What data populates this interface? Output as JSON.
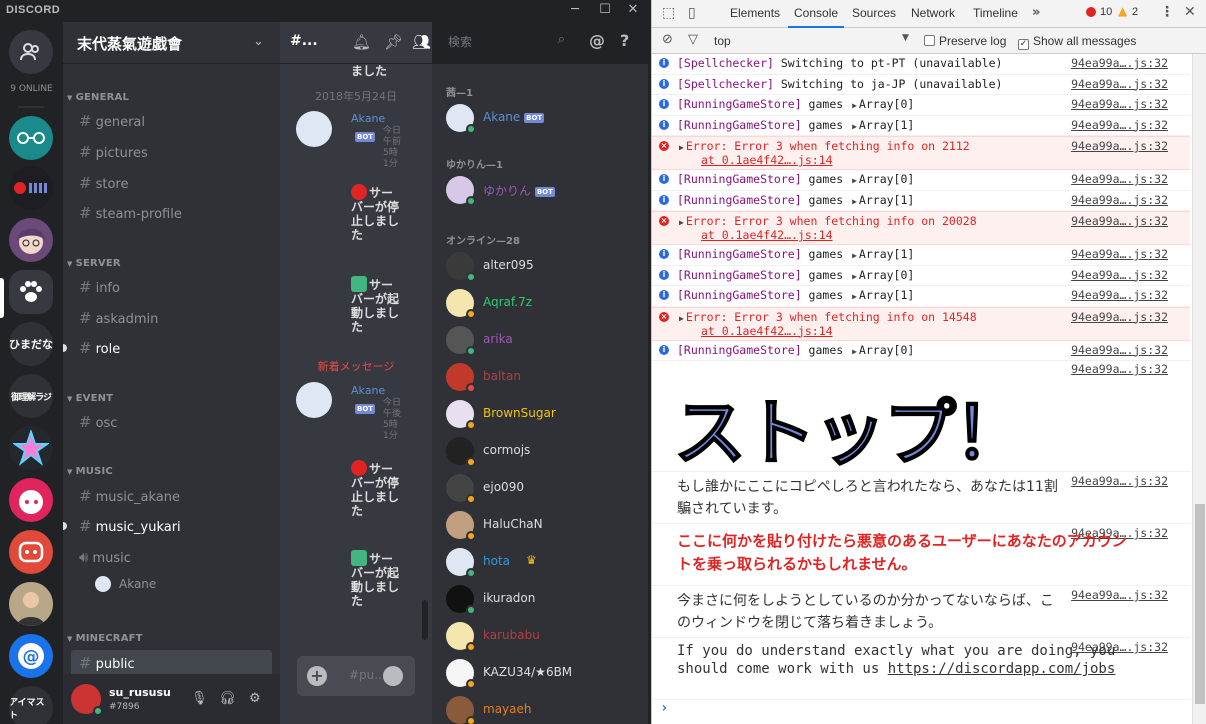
{
  "titlebar": {
    "brand": "DISCORD",
    "min": "─",
    "max": "☐",
    "close": "✕"
  },
  "guilds": {
    "online": "9 ONLINE",
    "items": [
      {
        "label": "ひまだな"
      },
      {
        "label": "御理解ラジ"
      },
      {
        "label": "アイマスト"
      }
    ]
  },
  "server": {
    "name": "末代蒸氣遊戯會"
  },
  "categories": [
    {
      "name": "GENERAL",
      "channels": [
        "general",
        "pictures",
        "store",
        "steam-profile"
      ]
    },
    {
      "name": "SERVER",
      "channels": [
        "info",
        "askadmin",
        "role"
      ]
    },
    {
      "name": "EVENT",
      "channels": [
        "osc"
      ]
    },
    {
      "name": "MUSIC",
      "channels": [
        "music_akane",
        "music_yukari",
        "music"
      ]
    },
    {
      "name": "MINECRAFT",
      "channels": [
        "public"
      ]
    }
  ],
  "voice_user": "Akane",
  "user": {
    "name": "su_rususu",
    "tag": "#7896"
  },
  "chat": {
    "channel": "#...",
    "search_placeholder": "検索",
    "top_text": "ました",
    "date_divider": "2018年5月24日",
    "new_divider": "新着メッセージ",
    "msg1": {
      "author": "Akane",
      "bot": "BOT",
      "time": "今日 午前5時1分"
    },
    "msg2": {
      "author": "Akane",
      "bot": "BOT",
      "time": "今日 午後5時1分"
    },
    "stop_text": "サーバーが停止しました",
    "start_text": "サーバーが起動しました",
    "input_placeholder": "#pu..."
  },
  "members": {
    "groups": [
      {
        "name": "茜—1",
        "items": [
          {
            "name": "Akane",
            "bot": "BOT",
            "color": "#5d8fd0"
          }
        ]
      },
      {
        "name": "ゆかりん—1",
        "items": [
          {
            "name": "ゆかりん",
            "bot": "BOT",
            "color": "#9b59b6"
          }
        ]
      },
      {
        "name": "オンライン—28",
        "items": [
          {
            "name": "alter095",
            "color": "#dcddde",
            "status": "#43b581"
          },
          {
            "name": "Aqraf.7z",
            "color": "#2ecc71",
            "status": "#faa61a"
          },
          {
            "name": "arika",
            "color": "#9b59b6",
            "status": "#43b581"
          },
          {
            "name": "baltan",
            "color": "#b04040",
            "status": "#f04747"
          },
          {
            "name": "BrownSugar",
            "color": "#f1c40f",
            "status": "#faa61a"
          },
          {
            "name": "cormojs",
            "color": "#dcddde",
            "status": "#faa61a"
          },
          {
            "name": "ejo090",
            "color": "#dcddde",
            "status": "#faa61a"
          },
          {
            "name": "HaluChaN",
            "color": "#dcddde",
            "status": "#faa61a"
          },
          {
            "name": "hota",
            "color": "#3498db",
            "status": "#43b581",
            "crown": "♛"
          },
          {
            "name": "ikuradon",
            "color": "#dcddde",
            "status": "#43b581"
          },
          {
            "name": "karubabu",
            "color": "#b04040",
            "status": "#faa61a"
          },
          {
            "name": "KAZU34/★6BM",
            "color": "#dcddde",
            "status": "#faa61a"
          },
          {
            "name": "mayaeh",
            "color": "#e67e22",
            "status": "#faa61a"
          }
        ]
      }
    ]
  },
  "devtools": {
    "tabs": [
      "Elements",
      "Console",
      "Sources",
      "Network",
      "Timeline"
    ],
    "errors": "10",
    "warnings": "2",
    "context": "top",
    "preserve_log": "Preserve log",
    "show_all": "Show all messages",
    "src": "94ea99a….js:32",
    "rows": [
      {
        "type": "info",
        "tag": "[Spellchecker]",
        "text": " Switching to pt-PT (unavailable)"
      },
      {
        "type": "info",
        "tag": "[Spellchecker]",
        "text": " Switching to ja-JP (unavailable)"
      },
      {
        "type": "info",
        "tag": "[RunningGameStore]",
        "text": " games ",
        "arr": "Array[0]"
      },
      {
        "type": "info",
        "tag": "[RunningGameStore]",
        "text": " games ",
        "arr": "Array[1]"
      },
      {
        "type": "error",
        "text": "Error: Error 3 when fetching info on 2112",
        "at": "at 0.1ae4f42….js:14"
      },
      {
        "type": "info",
        "tag": "[RunningGameStore]",
        "text": " games ",
        "arr": "Array[0]"
      },
      {
        "type": "info",
        "tag": "[RunningGameStore]",
        "text": " games ",
        "arr": "Array[1]"
      },
      {
        "type": "error",
        "text": "Error: Error 3 when fetching info on 20028",
        "at": "at 0.1ae4f42….js:14"
      },
      {
        "type": "info",
        "tag": "[RunningGameStore]",
        "text": " games ",
        "arr": "Array[1]"
      },
      {
        "type": "info",
        "tag": "[RunningGameStore]",
        "text": " games ",
        "arr": "Array[0]"
      },
      {
        "type": "info",
        "tag": "[RunningGameStore]",
        "text": " games ",
        "arr": "Array[1]"
      },
      {
        "type": "error",
        "text": "Error: Error 3 when fetching info on 14548",
        "at": "at 0.1ae4f42….js:14"
      },
      {
        "type": "info",
        "tag": "[RunningGameStore]",
        "text": " games ",
        "arr": "Array[0]"
      }
    ],
    "stop": "ストップ！",
    "warn1": "もし誰かにここにコピペしろと言われたなら、あなたは11割騙されています。",
    "warn2": "ここに何かを貼り付けたら悪意のあるユーザーにあなたのアカウントを乗っ取られるかもしれません。",
    "warn3": "今まさに何をしようとしているのか分かってないならば、このウィンドウを閉じて落ち着きましょう。",
    "warn4": "If you do understand exactly what you are doing, you should come work with us ",
    "warn4_link": "https://discordapp.com/jobs",
    "prompt": "›"
  }
}
